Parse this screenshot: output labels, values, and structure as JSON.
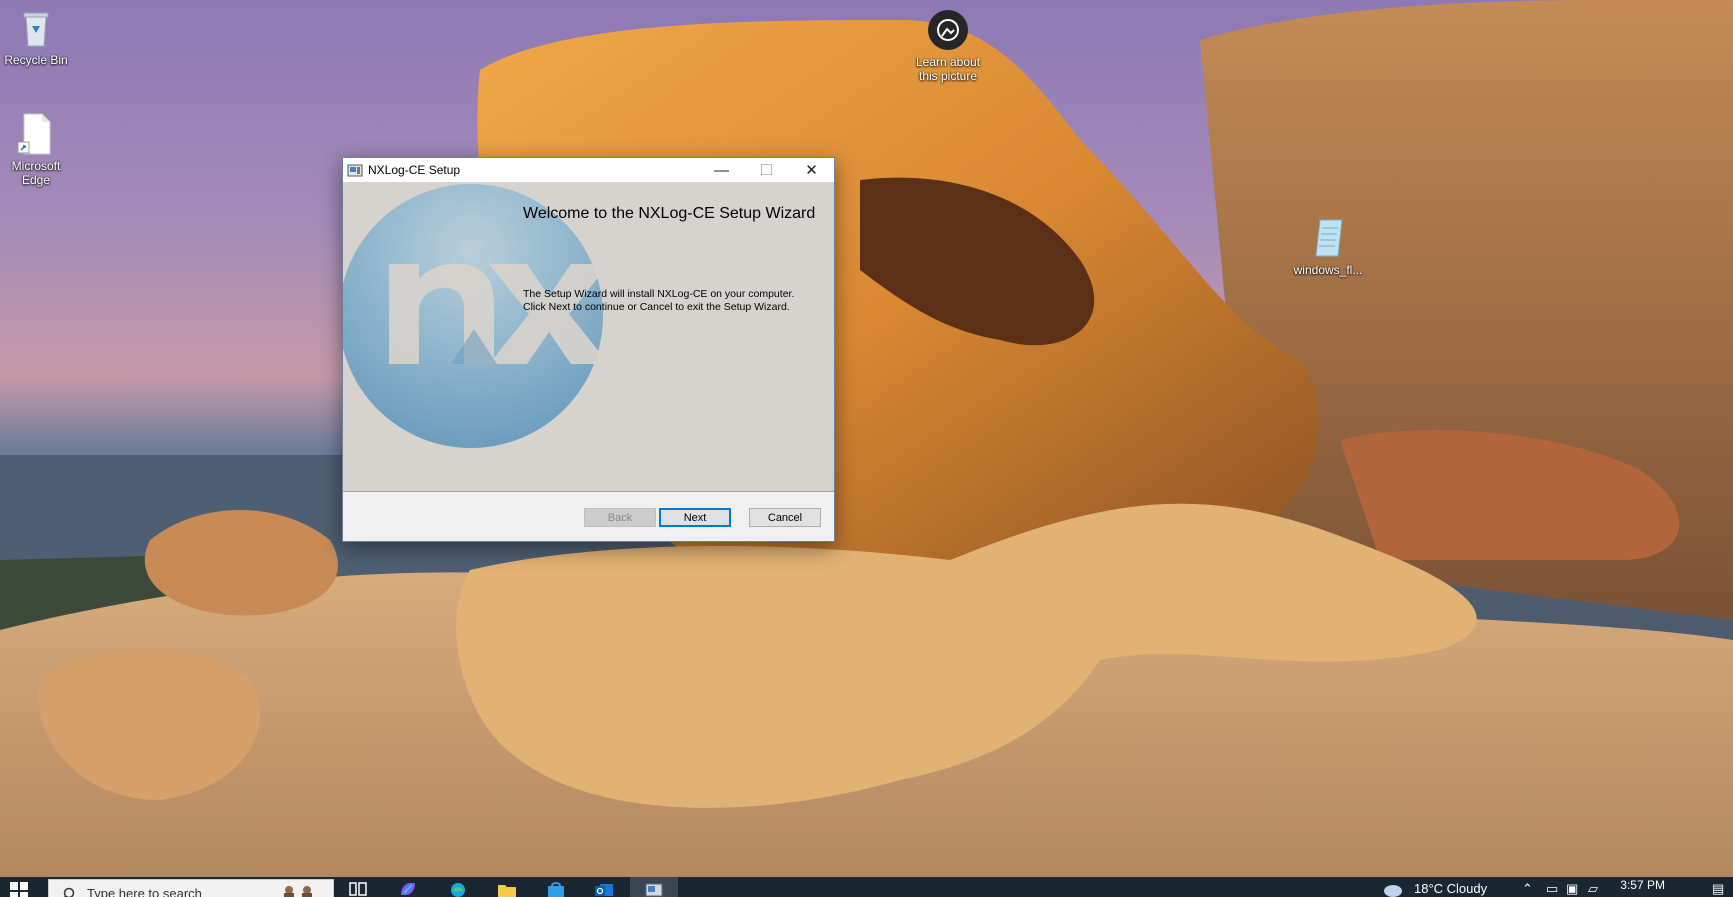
{
  "desktop": {
    "icons": [
      {
        "label": "Recycle Bin"
      },
      {
        "label": "Microsoft Edge"
      },
      {
        "label": "Learn about this picture"
      },
      {
        "label": "windows_fl..."
      }
    ]
  },
  "window": {
    "title": "NXLog-CE Setup",
    "controls": {
      "minimize": "—",
      "maximize": "☐",
      "close": "✕"
    },
    "welcome_title": "Welcome to the NXLog-CE Setup Wizard",
    "body_line1": "The Setup Wizard will install NXLog-CE on your computer.",
    "body_line2": "Click Next to continue or Cancel to exit the Setup Wizard.",
    "buttons": {
      "back": "Back",
      "next": "Next",
      "cancel": "Cancel"
    }
  },
  "taskbar": {
    "search_placeholder": "Type here to search",
    "weather": "18°C  Cloudy",
    "clock": "3:57 PM"
  },
  "colors": {
    "accent": "#0078d7",
    "taskbar": "#1b2633"
  }
}
